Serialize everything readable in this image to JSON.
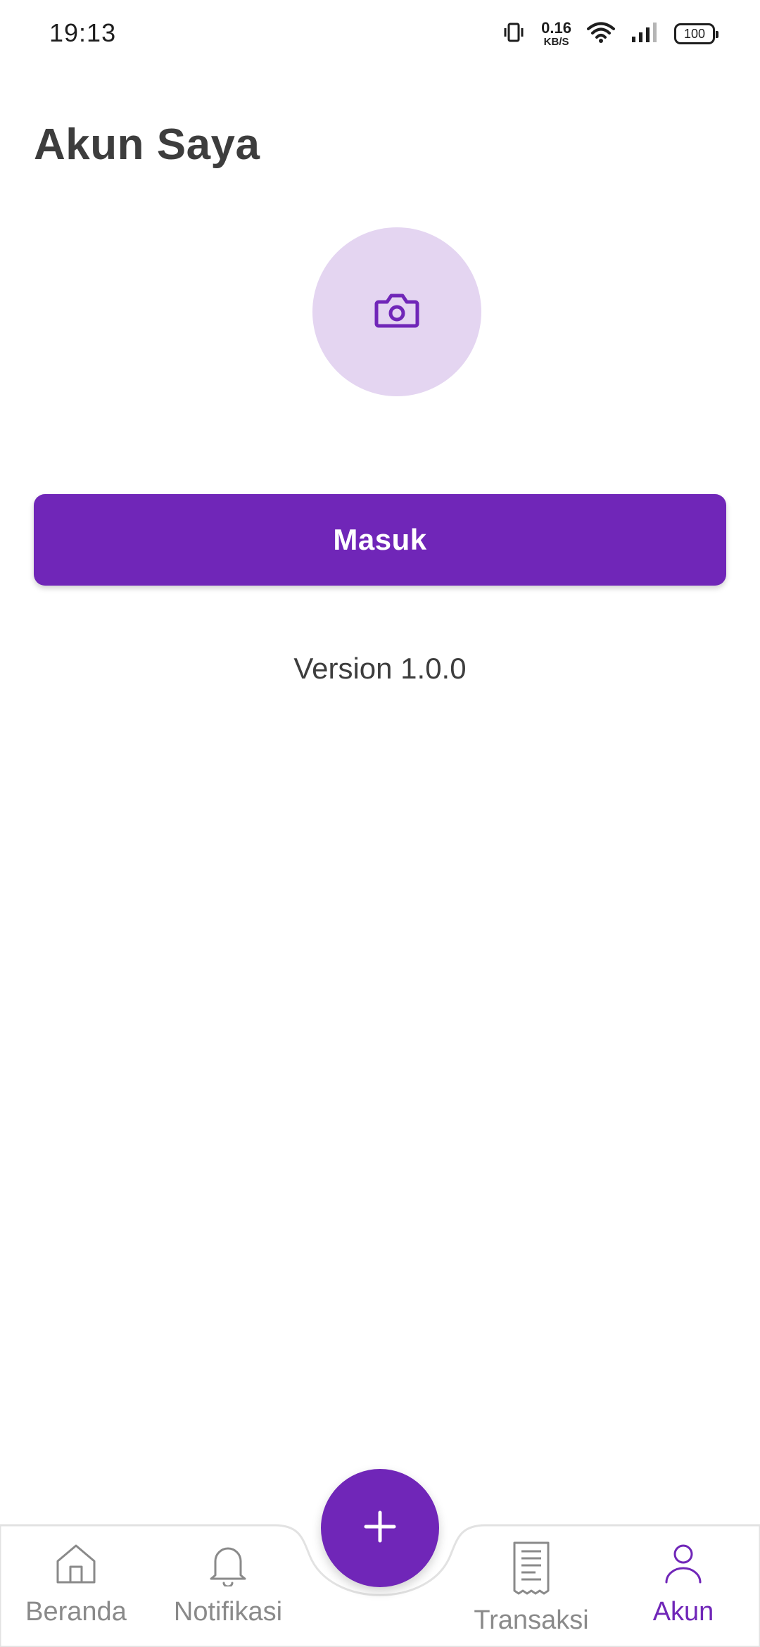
{
  "status_bar": {
    "time": "19:13",
    "net_speed_value": "0.16",
    "net_speed_unit": "KB/S",
    "battery": "100"
  },
  "header": {
    "title": "Akun Saya"
  },
  "avatar": {
    "icon": "camera-icon"
  },
  "login": {
    "label": "Masuk"
  },
  "version": {
    "text": "Version 1.0.0"
  },
  "bottom_nav": {
    "items": [
      {
        "label": "Beranda",
        "icon": "home-icon",
        "active": false
      },
      {
        "label": "Notifikasi",
        "icon": "bell-icon",
        "active": false
      },
      {
        "label": "Transaksi",
        "icon": "receipt-icon",
        "active": false
      },
      {
        "label": "Akun",
        "icon": "user-icon",
        "active": true
      }
    ],
    "fab_icon": "plus-icon"
  },
  "colors": {
    "accent": "#7026b8",
    "avatar_bg": "#e4d5f1",
    "text": "#3d3d3d",
    "inactive": "#8a8a8a"
  }
}
